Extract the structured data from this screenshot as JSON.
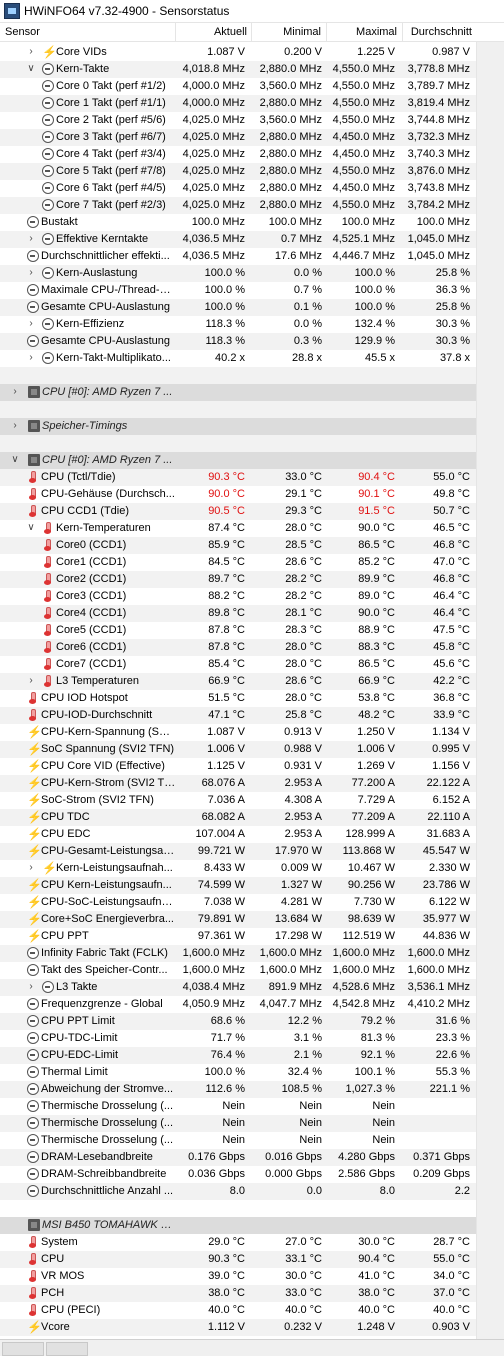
{
  "window": {
    "title": "HWiNFO64 v7.32-4900 - Sensorstatus"
  },
  "columns": {
    "sensor": "Sensor",
    "current": "Aktuell",
    "min": "Minimal",
    "max": "Maximal",
    "avg": "Durchschnitt"
  },
  "colors": {
    "hot": "#e01010",
    "group_bg": "#dcdcdc"
  },
  "rows": [
    {
      "indent": 2,
      "exp": "collapsed",
      "icon": "lightning",
      "label": "Core VIDs",
      "cur": "1.087 V",
      "min": "0.200 V",
      "max": "1.225 V",
      "avg": "0.987 V"
    },
    {
      "indent": 2,
      "exp": "expanded",
      "icon": "clock",
      "label": "Kern-Takte",
      "cur": "4,018.8 MHz",
      "min": "2,880.0 MHz",
      "max": "4,550.0 MHz",
      "avg": "3,778.8 MHz"
    },
    {
      "indent": 3,
      "icon": "clock",
      "label": "Core 0 Takt (perf #1/2)",
      "cur": "4,000.0 MHz",
      "min": "3,560.0 MHz",
      "max": "4,550.0 MHz",
      "avg": "3,789.7 MHz"
    },
    {
      "indent": 3,
      "icon": "clock",
      "label": "Core 1 Takt (perf #1/1)",
      "cur": "4,000.0 MHz",
      "min": "2,880.0 MHz",
      "max": "4,550.0 MHz",
      "avg": "3,819.4 MHz"
    },
    {
      "indent": 3,
      "icon": "clock",
      "label": "Core 2 Takt (perf #5/6)",
      "cur": "4,025.0 MHz",
      "min": "3,560.0 MHz",
      "max": "4,550.0 MHz",
      "avg": "3,744.8 MHz"
    },
    {
      "indent": 3,
      "icon": "clock",
      "label": "Core 3 Takt (perf #6/7)",
      "cur": "4,025.0 MHz",
      "min": "2,880.0 MHz",
      "max": "4,450.0 MHz",
      "avg": "3,732.3 MHz"
    },
    {
      "indent": 3,
      "icon": "clock",
      "label": "Core 4 Takt (perf #3/4)",
      "cur": "4,025.0 MHz",
      "min": "2,880.0 MHz",
      "max": "4,450.0 MHz",
      "avg": "3,740.3 MHz"
    },
    {
      "indent": 3,
      "icon": "clock",
      "label": "Core 5 Takt (perf #7/8)",
      "cur": "4,025.0 MHz",
      "min": "2,880.0 MHz",
      "max": "4,550.0 MHz",
      "avg": "3,876.0 MHz"
    },
    {
      "indent": 3,
      "icon": "clock",
      "label": "Core 6 Takt (perf #4/5)",
      "cur": "4,025.0 MHz",
      "min": "2,880.0 MHz",
      "max": "4,450.0 MHz",
      "avg": "3,743.8 MHz"
    },
    {
      "indent": 3,
      "icon": "clock",
      "label": "Core 7 Takt (perf #2/3)",
      "cur": "4,025.0 MHz",
      "min": "2,880.0 MHz",
      "max": "4,550.0 MHz",
      "avg": "3,784.2 MHz"
    },
    {
      "indent": 1,
      "icon": "clock",
      "label": "Bustakt",
      "cur": "100.0 MHz",
      "min": "100.0 MHz",
      "max": "100.0 MHz",
      "avg": "100.0 MHz"
    },
    {
      "indent": 2,
      "exp": "collapsed",
      "icon": "clock",
      "label": "Effektive Kerntakte",
      "cur": "4,036.5 MHz",
      "min": "0.7 MHz",
      "max": "4,525.1 MHz",
      "avg": "1,045.0 MHz"
    },
    {
      "indent": 1,
      "icon": "clock",
      "label": "Durchschnittlicher effekti...",
      "cur": "4,036.5 MHz",
      "min": "17.6 MHz",
      "max": "4,446.7 MHz",
      "avg": "1,045.0 MHz"
    },
    {
      "indent": 2,
      "exp": "collapsed",
      "icon": "clock",
      "label": "Kern-Auslastung",
      "cur": "100.0 %",
      "min": "0.0 %",
      "max": "100.0 %",
      "avg": "25.8 %"
    },
    {
      "indent": 1,
      "icon": "clock",
      "label": "Maximale CPU-/Thread-A...",
      "cur": "100.0 %",
      "min": "0.7 %",
      "max": "100.0 %",
      "avg": "36.3 %"
    },
    {
      "indent": 1,
      "icon": "clock",
      "label": "Gesamte CPU-Auslastung",
      "cur": "100.0 %",
      "min": "0.1 %",
      "max": "100.0 %",
      "avg": "25.8 %"
    },
    {
      "indent": 2,
      "exp": "collapsed",
      "icon": "clock",
      "label": "Kern-Effizienz",
      "cur": "118.3 %",
      "min": "0.0 %",
      "max": "132.4 %",
      "avg": "30.3 %"
    },
    {
      "indent": 1,
      "icon": "clock",
      "label": "Gesamte CPU-Auslastung",
      "cur": "118.3 %",
      "min": "0.3 %",
      "max": "129.9 %",
      "avg": "30.3 %"
    },
    {
      "indent": 2,
      "exp": "collapsed",
      "icon": "clock",
      "label": "Kern-Takt-Multiplikato...",
      "cur": "40.2 x",
      "min": "28.8 x",
      "max": "45.5 x",
      "avg": "37.8 x"
    },
    {
      "blank": true
    },
    {
      "group": true,
      "exp": "collapsed",
      "icon": "chip",
      "label": "CPU [#0]: AMD Ryzen 7 ..."
    },
    {
      "blank": true
    },
    {
      "group": true,
      "exp": "collapsed",
      "icon": "chip",
      "label": "Speicher-Timings"
    },
    {
      "blank": true
    },
    {
      "group": true,
      "exp": "expanded",
      "icon": "chip",
      "label": "CPU [#0]: AMD Ryzen 7 ..."
    },
    {
      "indent": 1,
      "icon": "thermo",
      "label": "CPU (Tctl/Tdie)",
      "cur": "90.3 °C",
      "min": "33.0 °C",
      "max": "90.4 °C",
      "avg": "55.0 °C",
      "hotCur": true,
      "hotMax": true
    },
    {
      "indent": 1,
      "icon": "thermo",
      "label": "CPU-Gehäuse (Durchsch...",
      "cur": "90.0 °C",
      "min": "29.1 °C",
      "max": "90.1 °C",
      "avg": "49.8 °C",
      "hotCur": true,
      "hotMax": true
    },
    {
      "indent": 1,
      "icon": "thermo",
      "label": "CPU CCD1 (Tdie)",
      "cur": "90.5 °C",
      "min": "29.3 °C",
      "max": "91.5 °C",
      "avg": "50.7 °C",
      "hotCur": true,
      "hotMax": true
    },
    {
      "indent": 2,
      "exp": "expanded",
      "icon": "thermo",
      "label": "Kern-Temperaturen",
      "cur": "87.4 °C",
      "min": "28.0 °C",
      "max": "90.0 °C",
      "avg": "46.5 °C"
    },
    {
      "indent": 3,
      "icon": "thermo",
      "label": "Core0 (CCD1)",
      "cur": "85.9 °C",
      "min": "28.5 °C",
      "max": "86.5 °C",
      "avg": "46.8 °C"
    },
    {
      "indent": 3,
      "icon": "thermo",
      "label": "Core1 (CCD1)",
      "cur": "84.5 °C",
      "min": "28.6 °C",
      "max": "85.2 °C",
      "avg": "47.0 °C"
    },
    {
      "indent": 3,
      "icon": "thermo",
      "label": "Core2 (CCD1)",
      "cur": "89.7 °C",
      "min": "28.2 °C",
      "max": "89.9 °C",
      "avg": "46.8 °C"
    },
    {
      "indent": 3,
      "icon": "thermo",
      "label": "Core3 (CCD1)",
      "cur": "88.2 °C",
      "min": "28.2 °C",
      "max": "89.0 °C",
      "avg": "46.4 °C"
    },
    {
      "indent": 3,
      "icon": "thermo",
      "label": "Core4 (CCD1)",
      "cur": "89.8 °C",
      "min": "28.1 °C",
      "max": "90.0 °C",
      "avg": "46.4 °C"
    },
    {
      "indent": 3,
      "icon": "thermo",
      "label": "Core5 (CCD1)",
      "cur": "87.8 °C",
      "min": "28.3 °C",
      "max": "88.9 °C",
      "avg": "47.5 °C"
    },
    {
      "indent": 3,
      "icon": "thermo",
      "label": "Core6 (CCD1)",
      "cur": "87.8 °C",
      "min": "28.0 °C",
      "max": "88.3 °C",
      "avg": "45.8 °C"
    },
    {
      "indent": 3,
      "icon": "thermo",
      "label": "Core7 (CCD1)",
      "cur": "85.4 °C",
      "min": "28.0 °C",
      "max": "86.5 °C",
      "avg": "45.6 °C"
    },
    {
      "indent": 2,
      "exp": "collapsed",
      "icon": "thermo",
      "label": "L3 Temperaturen",
      "cur": "66.9 °C",
      "min": "28.6 °C",
      "max": "66.9 °C",
      "avg": "42.2 °C"
    },
    {
      "indent": 1,
      "icon": "thermo",
      "label": "CPU IOD Hotspot",
      "cur": "51.5 °C",
      "min": "28.0 °C",
      "max": "53.8 °C",
      "avg": "36.8 °C"
    },
    {
      "indent": 1,
      "icon": "thermo",
      "label": "CPU-IOD-Durchschnitt",
      "cur": "47.1 °C",
      "min": "25.8 °C",
      "max": "48.2 °C",
      "avg": "33.9 °C"
    },
    {
      "indent": 1,
      "icon": "lightning",
      "label": "CPU-Kern-Spannung (SVI...",
      "cur": "1.087 V",
      "min": "0.913 V",
      "max": "1.250 V",
      "avg": "1.134 V"
    },
    {
      "indent": 1,
      "icon": "lightning",
      "label": "SoC Spannung (SVI2 TFN)",
      "cur": "1.006 V",
      "min": "0.988 V",
      "max": "1.006 V",
      "avg": "0.995 V"
    },
    {
      "indent": 1,
      "icon": "lightning",
      "label": "CPU Core VID (Effective)",
      "cur": "1.125 V",
      "min": "0.931 V",
      "max": "1.269 V",
      "avg": "1.156 V"
    },
    {
      "indent": 1,
      "icon": "lightning",
      "label": "CPU-Kern-Strom (SVI2 TFN)",
      "cur": "68.076 A",
      "min": "2.953 A",
      "max": "77.200 A",
      "avg": "22.122 A"
    },
    {
      "indent": 1,
      "icon": "lightning",
      "label": "SoC-Strom (SVI2 TFN)",
      "cur": "7.036 A",
      "min": "4.308 A",
      "max": "7.729 A",
      "avg": "6.152 A"
    },
    {
      "indent": 1,
      "icon": "lightning",
      "label": "CPU TDC",
      "cur": "68.082 A",
      "min": "2.953 A",
      "max": "77.209 A",
      "avg": "22.110 A"
    },
    {
      "indent": 1,
      "icon": "lightning",
      "label": "CPU EDC",
      "cur": "107.004 A",
      "min": "2.953 A",
      "max": "128.999 A",
      "avg": "31.683 A"
    },
    {
      "indent": 1,
      "icon": "lightning",
      "label": "CPU-Gesamt-Leistungsau...",
      "cur": "99.721 W",
      "min": "17.970 W",
      "max": "113.868 W",
      "avg": "45.547 W"
    },
    {
      "indent": 2,
      "exp": "collapsed",
      "icon": "lightning",
      "label": "Kern-Leistungsaufnah...",
      "cur": "8.433 W",
      "min": "0.009 W",
      "max": "10.467 W",
      "avg": "2.330 W"
    },
    {
      "indent": 1,
      "icon": "lightning",
      "label": "CPU Kern-Leistungsaufn...",
      "cur": "74.599 W",
      "min": "1.327 W",
      "max": "90.256 W",
      "avg": "23.786 W"
    },
    {
      "indent": 1,
      "icon": "lightning",
      "label": "CPU-SoC-Leistungsaufna...",
      "cur": "7.038 W",
      "min": "4.281 W",
      "max": "7.730 W",
      "avg": "6.122 W"
    },
    {
      "indent": 1,
      "icon": "lightning",
      "label": "Core+SoC Energieverbra...",
      "cur": "79.891 W",
      "min": "13.684 W",
      "max": "98.639 W",
      "avg": "35.977 W"
    },
    {
      "indent": 1,
      "icon": "lightning",
      "label": "CPU PPT",
      "cur": "97.361 W",
      "min": "17.298 W",
      "max": "112.519 W",
      "avg": "44.836 W"
    },
    {
      "indent": 1,
      "icon": "clock",
      "label": "Infinity Fabric Takt (FCLK)",
      "cur": "1,600.0 MHz",
      "min": "1,600.0 MHz",
      "max": "1,600.0 MHz",
      "avg": "1,600.0 MHz"
    },
    {
      "indent": 1,
      "icon": "clock",
      "label": "Takt des Speicher-Contr...",
      "cur": "1,600.0 MHz",
      "min": "1,600.0 MHz",
      "max": "1,600.0 MHz",
      "avg": "1,600.0 MHz"
    },
    {
      "indent": 2,
      "exp": "collapsed",
      "icon": "clock",
      "label": "L3 Takte",
      "cur": "4,038.4 MHz",
      "min": "891.9 MHz",
      "max": "4,528.6 MHz",
      "avg": "3,536.1 MHz"
    },
    {
      "indent": 1,
      "icon": "clock",
      "label": "Frequenzgrenze - Global",
      "cur": "4,050.9 MHz",
      "min": "4,047.7 MHz",
      "max": "4,542.8 MHz",
      "avg": "4,410.2 MHz"
    },
    {
      "indent": 1,
      "icon": "clock",
      "label": "CPU PPT Limit",
      "cur": "68.6 %",
      "min": "12.2 %",
      "max": "79.2 %",
      "avg": "31.6 %"
    },
    {
      "indent": 1,
      "icon": "clock",
      "label": "CPU-TDC-Limit",
      "cur": "71.7 %",
      "min": "3.1 %",
      "max": "81.3 %",
      "avg": "23.3 %"
    },
    {
      "indent": 1,
      "icon": "clock",
      "label": "CPU-EDC-Limit",
      "cur": "76.4 %",
      "min": "2.1 %",
      "max": "92.1 %",
      "avg": "22.6 %"
    },
    {
      "indent": 1,
      "icon": "clock",
      "label": "Thermal Limit",
      "cur": "100.0 %",
      "min": "32.4 %",
      "max": "100.1 %",
      "avg": "55.3 %"
    },
    {
      "indent": 1,
      "icon": "clock",
      "label": "Abweichung der Stromve...",
      "cur": "112.6 %",
      "min": "108.5 %",
      "max": "1,027.3 %",
      "avg": "221.1 %"
    },
    {
      "indent": 1,
      "icon": "clock",
      "label": "Thermische Drosselung (...",
      "cur": "Nein",
      "min": "Nein",
      "max": "Nein",
      "avg": ""
    },
    {
      "indent": 1,
      "icon": "clock",
      "label": "Thermische Drosselung (...",
      "cur": "Nein",
      "min": "Nein",
      "max": "Nein",
      "avg": ""
    },
    {
      "indent": 1,
      "icon": "clock",
      "label": "Thermische Drosselung (...",
      "cur": "Nein",
      "min": "Nein",
      "max": "Nein",
      "avg": ""
    },
    {
      "indent": 1,
      "icon": "clock",
      "label": "DRAM-Lesebandbreite",
      "cur": "0.176 Gbps",
      "min": "0.016 Gbps",
      "max": "4.280 Gbps",
      "avg": "0.371 Gbps"
    },
    {
      "indent": 1,
      "icon": "clock",
      "label": "DRAM-Schreibbandbreite",
      "cur": "0.036 Gbps",
      "min": "0.000 Gbps",
      "max": "2.586 Gbps",
      "avg": "0.209 Gbps"
    },
    {
      "indent": 1,
      "icon": "clock",
      "label": "Durchschnittliche Anzahl ...",
      "cur": "8.0",
      "min": "0.0",
      "max": "8.0",
      "avg": "2.2"
    },
    {
      "blank": true
    },
    {
      "group": true,
      "exp": "none",
      "icon": "chip",
      "label": "MSI B450 TOMAHAWK M..."
    },
    {
      "indent": 1,
      "icon": "thermo",
      "label": "System",
      "cur": "29.0 °C",
      "min": "27.0 °C",
      "max": "30.0 °C",
      "avg": "28.7 °C"
    },
    {
      "indent": 1,
      "icon": "thermo",
      "label": "CPU",
      "cur": "90.3 °C",
      "min": "33.1 °C",
      "max": "90.4 °C",
      "avg": "55.0 °C"
    },
    {
      "indent": 1,
      "icon": "thermo",
      "label": "VR MOS",
      "cur": "39.0 °C",
      "min": "30.0 °C",
      "max": "41.0 °C",
      "avg": "34.0 °C"
    },
    {
      "indent": 1,
      "icon": "thermo",
      "label": "PCH",
      "cur": "38.0 °C",
      "min": "33.0 °C",
      "max": "38.0 °C",
      "avg": "37.0 °C"
    },
    {
      "indent": 1,
      "icon": "thermo",
      "label": "CPU (PECI)",
      "cur": "40.0 °C",
      "min": "40.0 °C",
      "max": "40.0 °C",
      "avg": "40.0 °C"
    },
    {
      "indent": 1,
      "icon": "lightning",
      "label": "Vcore",
      "cur": "1.112 V",
      "min": "0.232 V",
      "max": "1.248 V",
      "avg": "0.903 V"
    }
  ]
}
